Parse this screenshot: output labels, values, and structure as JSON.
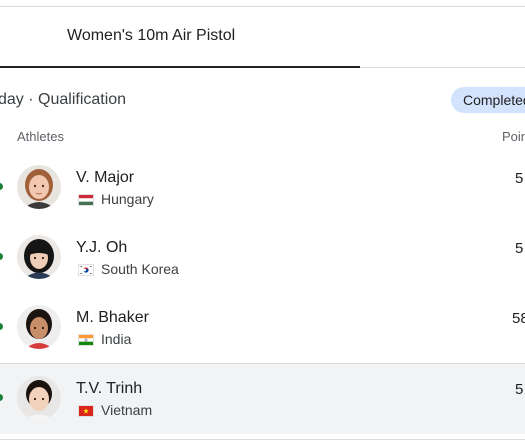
{
  "tabs": [
    {
      "label": "Women's 10m Air Pistol",
      "selected": true
    }
  ],
  "session": {
    "label": "day · Qualification",
    "status": "Completed"
  },
  "table": {
    "headers": {
      "athletes": "Athletes",
      "points": "Points"
    },
    "rows": [
      {
        "name": "V. Major",
        "country": "Hungary",
        "points": "5",
        "flag": "flag-hungary-icon"
      },
      {
        "name": "Y.J. Oh",
        "country": "South Korea",
        "points": "5",
        "flag": "flag-south-korea-icon"
      },
      {
        "name": "M. Bhaker",
        "country": "India",
        "points": "58",
        "flag": "flag-india-icon"
      },
      {
        "name": "T.V. Trinh",
        "country": "Vietnam",
        "points": "5",
        "flag": "flag-vietnam-icon"
      }
    ]
  },
  "colors": {
    "badge_bg": "#d3e3fd",
    "qualified_dot": "#188038",
    "tab_indicator": "#202124"
  }
}
